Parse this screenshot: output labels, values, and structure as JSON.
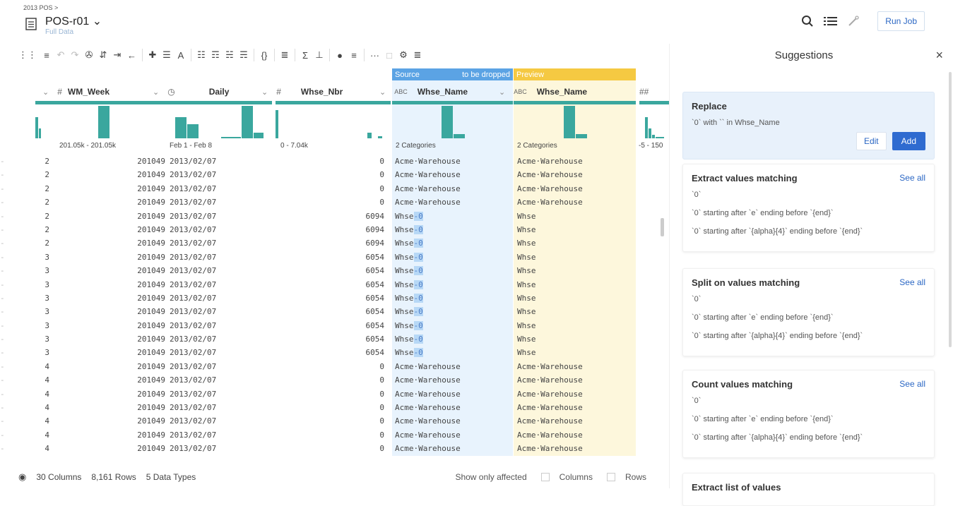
{
  "header": {
    "breadcrumb": "2013 POS >",
    "title": "POS-r01 ⌄",
    "subtitle": "Full Data",
    "run_job": "Run Job"
  },
  "toolbar": {
    "items": [
      "⋮⋮",
      "≡",
      "↶",
      "↷",
      "✇",
      "⇵",
      "⇥",
      "←",
      "✚",
      "☰",
      "A",
      "☷",
      "☶",
      "☵",
      "☴",
      "{}",
      "≣",
      "Σ",
      "⊥",
      "●",
      "≡",
      "···",
      "□",
      "⚙",
      "≣"
    ]
  },
  "suggestions": {
    "title": "Suggestions",
    "close": "×",
    "replace": {
      "heading": "Replace",
      "line_pre": "`0` with `` in Whse_Name",
      "edit": "Edit",
      "add": "Add"
    },
    "sections": [
      {
        "heading": "Extract values matching",
        "see_all": "See all",
        "lines": [
          "`0`",
          "`0` starting after `e` ending before `{end}`",
          "`0` starting after `{alpha}{4}` ending before `{end}`"
        ]
      },
      {
        "heading": "Split on values matching",
        "see_all": "See all",
        "lines": [
          "`0`",
          "`0` starting after `e` ending before `{end}`",
          "`0` starting after `{alpha}{4}` ending before `{end}`"
        ]
      },
      {
        "heading": "Count values matching",
        "see_all": "See all",
        "lines": [
          "`0`",
          "`0` starting after `e` ending before `{end}`",
          "`0` starting after `{alpha}{4}` ending before `{end}`"
        ]
      },
      {
        "heading": "Extract list of values",
        "see_all": "",
        "lines": []
      }
    ]
  },
  "grid": {
    "source_label": "Source",
    "to_be_dropped": "to be dropped",
    "preview_label": "Preview",
    "columns": [
      {
        "type": "#",
        "name": "WM_Week",
        "range": "201.05k - 201.05k"
      },
      {
        "type": "◷",
        "name": "Daily",
        "range": "Feb 1 - Feb 8"
      },
      {
        "type": "#",
        "name": "Whse_Nbr",
        "range": "0 - 7.04k"
      },
      {
        "type": "ABC",
        "name": "Whse_Name",
        "range": "2 Categories"
      },
      {
        "type": "ABC",
        "name": "Whse_Name",
        "range": "2 Categories"
      },
      {
        "type": "##",
        "name": "",
        "range": "-5 - 150"
      }
    ],
    "rows": [
      [
        "2",
        "201049",
        "2013/02/07",
        "0",
        "Acme·Warehouse",
        "Acme·Warehouse"
      ],
      [
        "2",
        "201049",
        "2013/02/07",
        "0",
        "Acme·Warehouse",
        "Acme·Warehouse"
      ],
      [
        "2",
        "201049",
        "2013/02/07",
        "0",
        "Acme·Warehouse",
        "Acme·Warehouse"
      ],
      [
        "2",
        "201049",
        "2013/02/07",
        "0",
        "Acme·Warehouse",
        "Acme·Warehouse"
      ],
      [
        "2",
        "201049",
        "2013/02/07",
        "6094",
        "Whse-0",
        "Whse"
      ],
      [
        "2",
        "201049",
        "2013/02/07",
        "6094",
        "Whse-0",
        "Whse"
      ],
      [
        "2",
        "201049",
        "2013/02/07",
        "6094",
        "Whse-0",
        "Whse"
      ],
      [
        "3",
        "201049",
        "2013/02/07",
        "6054",
        "Whse-0",
        "Whse"
      ],
      [
        "3",
        "201049",
        "2013/02/07",
        "6054",
        "Whse-0",
        "Whse"
      ],
      [
        "3",
        "201049",
        "2013/02/07",
        "6054",
        "Whse-0",
        "Whse"
      ],
      [
        "3",
        "201049",
        "2013/02/07",
        "6054",
        "Whse-0",
        "Whse"
      ],
      [
        "3",
        "201049",
        "2013/02/07",
        "6054",
        "Whse-0",
        "Whse"
      ],
      [
        "3",
        "201049",
        "2013/02/07",
        "6054",
        "Whse-0",
        "Whse"
      ],
      [
        "3",
        "201049",
        "2013/02/07",
        "6054",
        "Whse-0",
        "Whse"
      ],
      [
        "3",
        "201049",
        "2013/02/07",
        "6054",
        "Whse-0",
        "Whse"
      ],
      [
        "4",
        "201049",
        "2013/02/07",
        "0",
        "Acme·Warehouse",
        "Acme·Warehouse"
      ],
      [
        "4",
        "201049",
        "2013/02/07",
        "0",
        "Acme·Warehouse",
        "Acme·Warehouse"
      ],
      [
        "4",
        "201049",
        "2013/02/07",
        "0",
        "Acme·Warehouse",
        "Acme·Warehouse"
      ],
      [
        "4",
        "201049",
        "2013/02/07",
        "0",
        "Acme·Warehouse",
        "Acme·Warehouse"
      ],
      [
        "4",
        "201049",
        "2013/02/07",
        "0",
        "Acme·Warehouse",
        "Acme·Warehouse"
      ],
      [
        "4",
        "201049",
        "2013/02/07",
        "0",
        "Acme·Warehouse",
        "Acme·Warehouse"
      ],
      [
        "4",
        "201049",
        "2013/02/07",
        "0",
        "Acme·Warehouse",
        "Acme·Warehouse"
      ]
    ]
  },
  "footer": {
    "columns": "30 Columns",
    "rows": "8,161 Rows",
    "types": "5 Data Types",
    "show_only": "Show only affected",
    "cb_columns": "Columns",
    "cb_rows": "Rows"
  },
  "colors": {
    "accent": "#2f6bd0",
    "histogram": "#3aa79e",
    "source": "#5ba3e4",
    "preview": "#f5c942"
  }
}
